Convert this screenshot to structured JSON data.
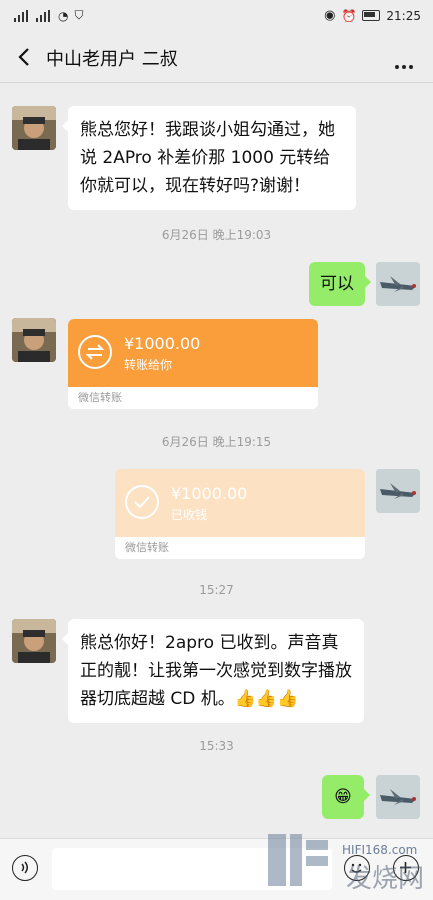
{
  "status_bar": {
    "network_left": "4G",
    "network_right": "4G",
    "time": "21:25"
  },
  "header": {
    "title": "中山老用户 二叔"
  },
  "messages": {
    "m1": "熊总您好！我跟谈小姐勾通过，她说 2APro 补差价那 1000 元转给你就可以，现在转好吗?谢谢！",
    "t1": "6月26日 晚上19:03",
    "m2": "可以",
    "transfer1": {
      "amount": "¥1000.00",
      "status": "转账给你",
      "footer": "微信转账"
    },
    "t2": "6月26日 晚上19:15",
    "transfer2": {
      "amount": "¥1000.00",
      "status": "已收钱",
      "footer": "微信转账"
    },
    "t3": "15:27",
    "m3": "熊总你好！2apro 已收到。声音真正的靓！让我第一次感觉到数字播放器切底超越 CD 机。👍👍👍",
    "t4": "15:33",
    "m4": "😁"
  },
  "watermark": {
    "url": "HIFI168.com",
    "text": "发烧网"
  },
  "colors": {
    "outgoing": "#95ec69",
    "transfer": "#fa9d3b",
    "transfer_received": "#fde1c3"
  }
}
